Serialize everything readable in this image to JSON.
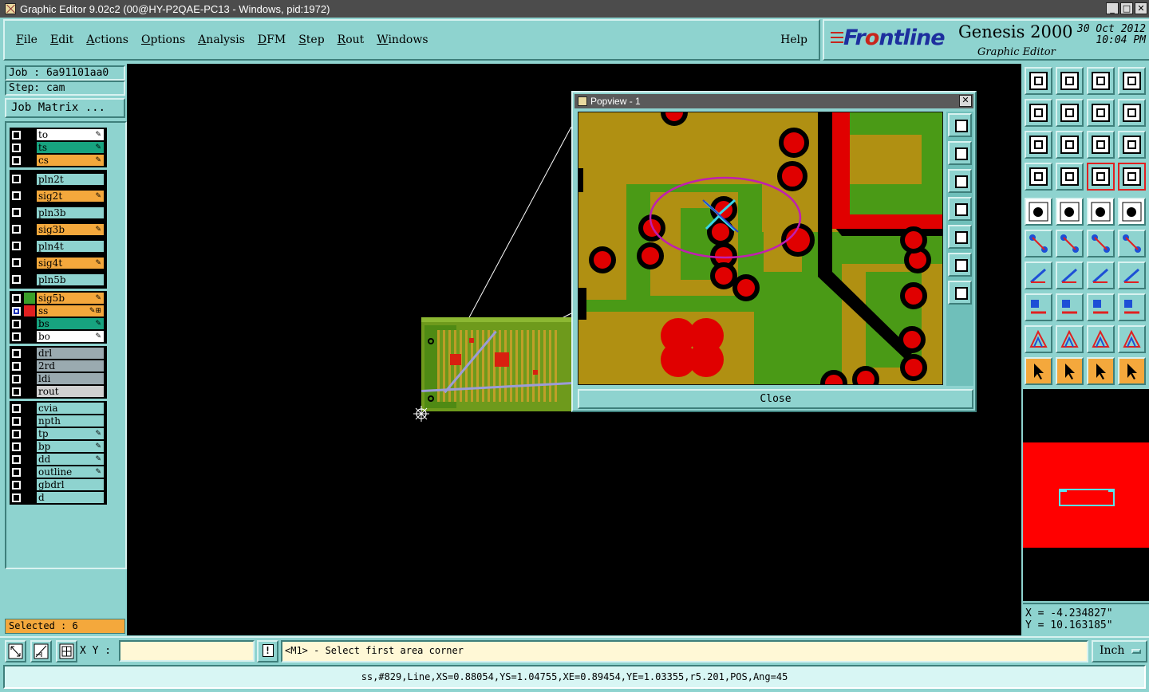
{
  "window": {
    "title": "Graphic Editor 9.02c2 (00@HY-P2QAE-PC13 - Windows, pid:1972)",
    "min": "_",
    "max": "□",
    "close": "✕"
  },
  "menu": {
    "items": [
      {
        "label": "File",
        "key": "F",
        "rest": "ile"
      },
      {
        "label": "Edit",
        "key": "E",
        "rest": "dit"
      },
      {
        "label": "Actions",
        "key": "A",
        "rest": "ctions"
      },
      {
        "label": "Options",
        "key": "O",
        "rest": "ptions"
      },
      {
        "label": "Analysis",
        "key": "A",
        "rest": "nalysis"
      },
      {
        "label": "DFM",
        "key": "D",
        "rest": "FM"
      },
      {
        "label": "Step",
        "key": "S",
        "rest": "tep"
      },
      {
        "label": "Rout",
        "key": "R",
        "rest": "out"
      },
      {
        "label": "Windows",
        "key": "W",
        "rest": "indows"
      }
    ],
    "help": "Help"
  },
  "brand": {
    "logo_a": "Fr",
    "logo_o": "o",
    "logo_b": "ntline",
    "product": "Genesis 2000",
    "subtitle": "Graphic Editor",
    "date": "30 Oct 2012",
    "time": "10:04 PM"
  },
  "job": {
    "job_line": "Job : 6a91101aa0",
    "step_line": "Step: cam",
    "matrix_button": "Job Matrix ..."
  },
  "layers": {
    "groups": [
      [
        {
          "name": "to",
          "color": "#ffffff",
          "mark": "✎"
        },
        {
          "name": "ts",
          "color": "#17a37f",
          "mark": "✎"
        },
        {
          "name": "cs",
          "color": "#f4a83c",
          "mark": "✎"
        }
      ],
      [
        {
          "name": "pln2t",
          "color": "#8ed3cf",
          "mark": "",
          "spaced": true
        },
        {
          "name": "sig2t",
          "color": "#f4a83c",
          "mark": "✎",
          "spaced": true
        },
        {
          "name": "pln3b",
          "color": "#8ed3cf",
          "mark": "",
          "spaced": true
        },
        {
          "name": "sig3b",
          "color": "#f4a83c",
          "mark": "✎",
          "spaced": true
        },
        {
          "name": "pln4t",
          "color": "#8ed3cf",
          "mark": "",
          "spaced": true
        },
        {
          "name": "sig4t",
          "color": "#f4a83c",
          "mark": "✎",
          "spaced": true
        },
        {
          "name": "pln5b",
          "color": "#8ed3cf",
          "mark": "",
          "spaced": true
        }
      ],
      [
        {
          "name": "sig5b",
          "color": "#f4a83c",
          "mark": "✎",
          "swatch": "#3aa02a"
        },
        {
          "name": "ss",
          "color": "#f4a83c",
          "mark": "✎⊞",
          "checked": true,
          "swatch": "#e02020"
        },
        {
          "name": "bs",
          "color": "#17a37f",
          "mark": "✎"
        },
        {
          "name": "bo",
          "color": "#ffffff",
          "mark": "✎"
        }
      ],
      [
        {
          "name": "drl",
          "color": "#9aaab0",
          "mark": ""
        },
        {
          "name": "2rd",
          "color": "#9aaab0",
          "mark": ""
        },
        {
          "name": "ldi",
          "color": "#9aaab0",
          "mark": ""
        },
        {
          "name": "rout",
          "color": "#d0d0d0",
          "mark": ""
        }
      ],
      [
        {
          "name": "cvia",
          "color": "#8ed3cf",
          "mark": ""
        },
        {
          "name": "npth",
          "color": "#8ed3cf",
          "mark": ""
        },
        {
          "name": "tp",
          "color": "#8ed3cf",
          "mark": "✎"
        },
        {
          "name": "bp",
          "color": "#8ed3cf",
          "mark": "✎"
        },
        {
          "name": "dd",
          "color": "#8ed3cf",
          "mark": "✎"
        },
        {
          "name": "outline",
          "color": "#8ed3cf",
          "mark": "✎"
        },
        {
          "name": "gbdrl",
          "color": "#8ed3cf",
          "mark": ""
        },
        {
          "name": "d",
          "color": "#8ed3cf",
          "mark": ""
        }
      ]
    ]
  },
  "selected": "Selected : 6",
  "popview": {
    "title": "Popview - 1",
    "close_x": "✕",
    "close_button": "Close"
  },
  "coords": {
    "x": "X = -4.234827\"",
    "y": "Y = 10.163185\""
  },
  "bottom": {
    "xy_label": "X Y :",
    "xy_value": "",
    "info": "!",
    "prompt": "<M1> - Select first area corner",
    "unit": "Inch"
  },
  "status": "ss,#829,Line,XS=0.88054,YS=1.04755,XE=0.89454,YE=1.03355,r5.201,POS,Ang=45"
}
